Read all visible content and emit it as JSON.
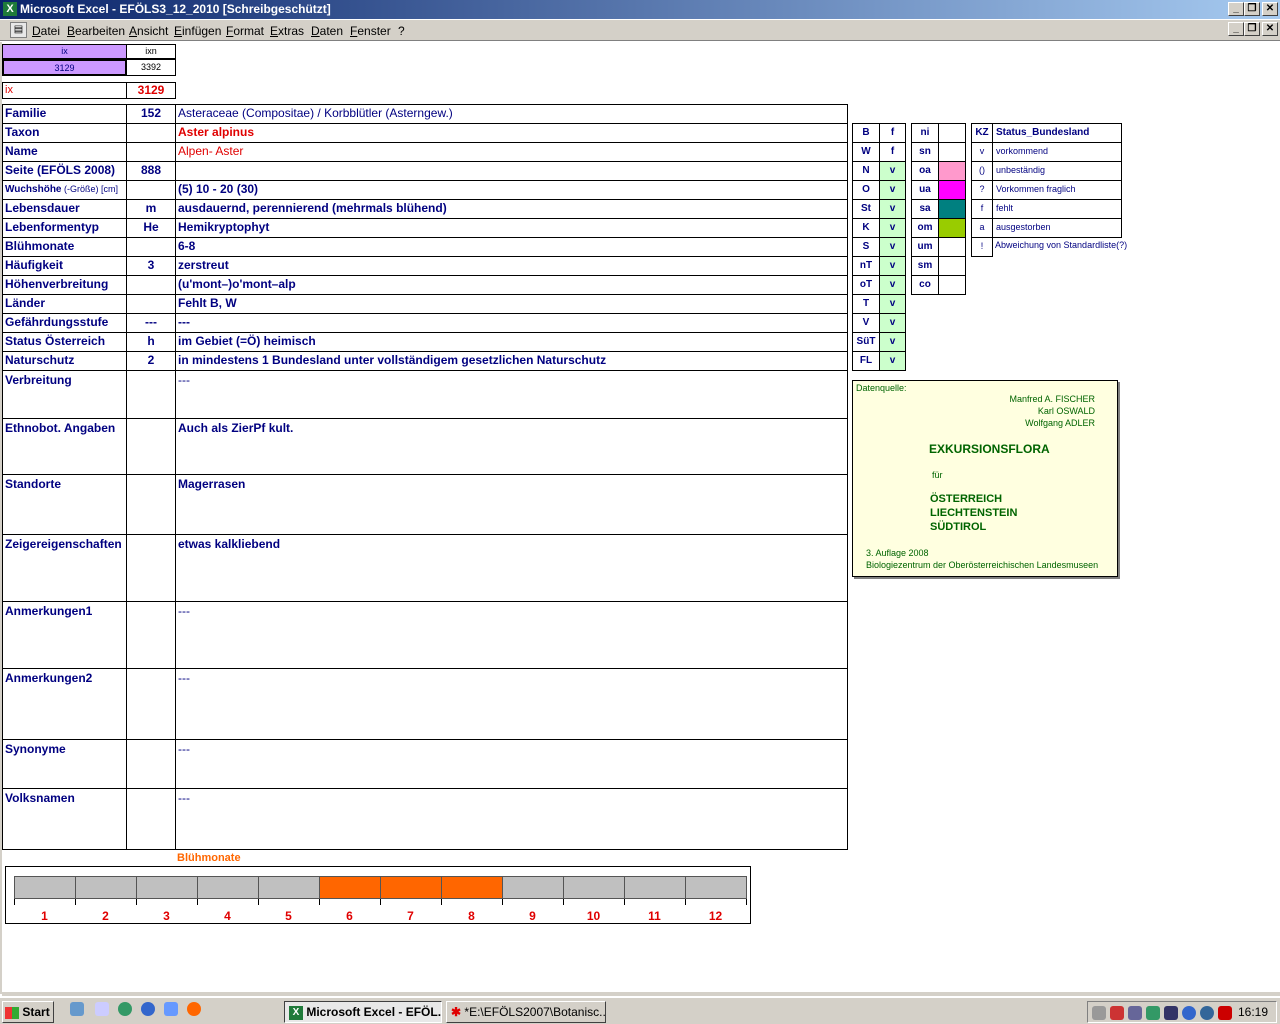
{
  "window": {
    "title": "Microsoft Excel - EFÖLS3_12_2010  [Schreibgeschützt]",
    "app_icon": "excel-icon",
    "controls": [
      "_",
      "❐",
      "✕"
    ]
  },
  "menu": [
    "Datei",
    "Bearbeiten",
    "Ansicht",
    "Einfügen",
    "Format",
    "Extras",
    "Daten",
    "Fenster",
    "?"
  ],
  "index_box": {
    "ix_header": "ix",
    "ixn_header": "ixn",
    "ix_value": "3129",
    "ixn_value": "3392",
    "ix_label": "ix",
    "ix_big": "3129"
  },
  "rows": [
    {
      "label": "Familie",
      "code": "152",
      "value": "Asteraceae (Compositae)  /  Korbblütler (Asterngew.)"
    },
    {
      "label": "Taxon",
      "code": "",
      "value": "Aster alpinus"
    },
    {
      "label": "Name",
      "code": "",
      "value": "Alpen- Aster"
    },
    {
      "label": "Seite (EFÖLS 2008)",
      "code": "888",
      "value": ""
    },
    {
      "label": "Wuchshöhe",
      "label_suffix": " (-Größe) [cm]",
      "code": "",
      "value": " (5) 10 - 20 (30)"
    },
    {
      "label": "Lebensdauer",
      "code": "m",
      "value": "ausdauernd, perennierend (mehrmals blühend)"
    },
    {
      "label": "Lebenformentyp",
      "code": "He",
      "value": "Hemikryptophyt"
    },
    {
      "label": "Blühmonate",
      "code": "",
      "value": " 6-8"
    },
    {
      "label": "Häufigkeit",
      "code": "3",
      "value": "zerstreut"
    },
    {
      "label": "Höhenverbreitung",
      "code": "",
      "value": "(u'mont–)o'mont–alp"
    },
    {
      "label": "Länder",
      "code": "",
      "value": "Fehlt B, W"
    },
    {
      "label": "Gefährdungsstufe",
      "code": "---",
      "value": "  ---"
    },
    {
      "label": "Status Österreich",
      "code": "h",
      "value": "im Gebiet (=Ö) heimisch"
    },
    {
      "label": "Naturschutz",
      "code": "2",
      "value": "in mindestens 1 Bundesland unter vollständigem gesetzlichen Naturschutz"
    }
  ],
  "big_rows": [
    {
      "label": "Verbreitung",
      "value": " ---"
    },
    {
      "label": "Ethnobot. Angaben",
      "value": "Auch als ZierPf kult."
    },
    {
      "label": "Standorte",
      "value": "Magerrasen"
    },
    {
      "label": "Zeigereigenschaften",
      "value": "etwas kalkliebend"
    },
    {
      "label": "Anmerkungen1",
      "value": "---"
    },
    {
      "label": "Anmerkungen2",
      "value": "---"
    },
    {
      "label": "Synonyme",
      "value": "---"
    },
    {
      "label": "Volksnamen",
      "value": "---"
    }
  ],
  "region_grid": [
    {
      "code": "B",
      "status": "f"
    },
    {
      "code": "W",
      "status": "f"
    },
    {
      "code": "N",
      "status": "v"
    },
    {
      "code": "O",
      "status": "v"
    },
    {
      "code": "St",
      "status": "v"
    },
    {
      "code": "K",
      "status": "v"
    },
    {
      "code": "S",
      "status": "v"
    },
    {
      "code": "nT",
      "status": "v"
    },
    {
      "code": "oT",
      "status": "v"
    },
    {
      "code": "T",
      "status": "v"
    },
    {
      "code": "V",
      "status": "v"
    },
    {
      "code": "SüT",
      "status": "v"
    },
    {
      "code": "FL",
      "status": "v"
    }
  ],
  "altitude_grid": [
    {
      "code": "ni",
      "color": ""
    },
    {
      "code": "sn",
      "color": ""
    },
    {
      "code": "oa",
      "color": "#ff99cc"
    },
    {
      "code": "ua",
      "color": "#ff00ff"
    },
    {
      "code": "sa",
      "color": "#008080"
    },
    {
      "code": "om",
      "color": "#99cc00"
    },
    {
      "code": "um",
      "color": ""
    },
    {
      "code": "sm",
      "color": ""
    },
    {
      "code": "co",
      "color": ""
    }
  ],
  "status_legend": {
    "kz_header": "KZ",
    "title": "Status_Bundesland",
    "items": [
      {
        "kz": "v",
        "text": "vorkommend"
      },
      {
        "kz": "()",
        "text": "unbeständig"
      },
      {
        "kz": "?",
        "text": "Vorkommen fraglich"
      },
      {
        "kz": "f",
        "text": "fehlt"
      },
      {
        "kz": "a",
        "text": "ausgestorben"
      },
      {
        "kz": "!",
        "text": "Abweichung von Standardliste(?)"
      }
    ]
  },
  "source": {
    "heading": "Datenquelle:",
    "authors": [
      "Manfred A. FISCHER",
      "Karl OSWALD",
      "Wolfgang ADLER"
    ],
    "work": "EXKURSIONSFLORA",
    "fuer": "für",
    "regions": [
      "ÖSTERREICH",
      "LIECHTENSTEIN",
      "SÜDTIROL"
    ],
    "edition": "3. Auflage 2008",
    "publisher": "Biologiezentrum der Oberösterreichischen Landesmuseen"
  },
  "chart_data": {
    "type": "bar",
    "title": "Blühmonate",
    "categories": [
      "1",
      "2",
      "3",
      "4",
      "5",
      "6",
      "7",
      "8",
      "9",
      "10",
      "11",
      "12"
    ],
    "values": [
      0,
      0,
      0,
      0,
      0,
      1,
      1,
      1,
      0,
      0,
      0,
      0
    ],
    "colors": {
      "on": "#ff6600",
      "off": "#c0c0c0"
    }
  },
  "taskbar": {
    "start": "Start",
    "quicklaunch": [
      "desktop-icon",
      "explorer-icon",
      "media-icon",
      "ie-icon",
      "outlook-icon",
      "firefox-icon"
    ],
    "tasks": [
      {
        "label": "Microsoft Excel - EFÖL...",
        "active": true
      },
      {
        "label": "*E:\\EFÖLS2007\\Botanisc...",
        "active": false
      }
    ],
    "clock": "16:19"
  }
}
